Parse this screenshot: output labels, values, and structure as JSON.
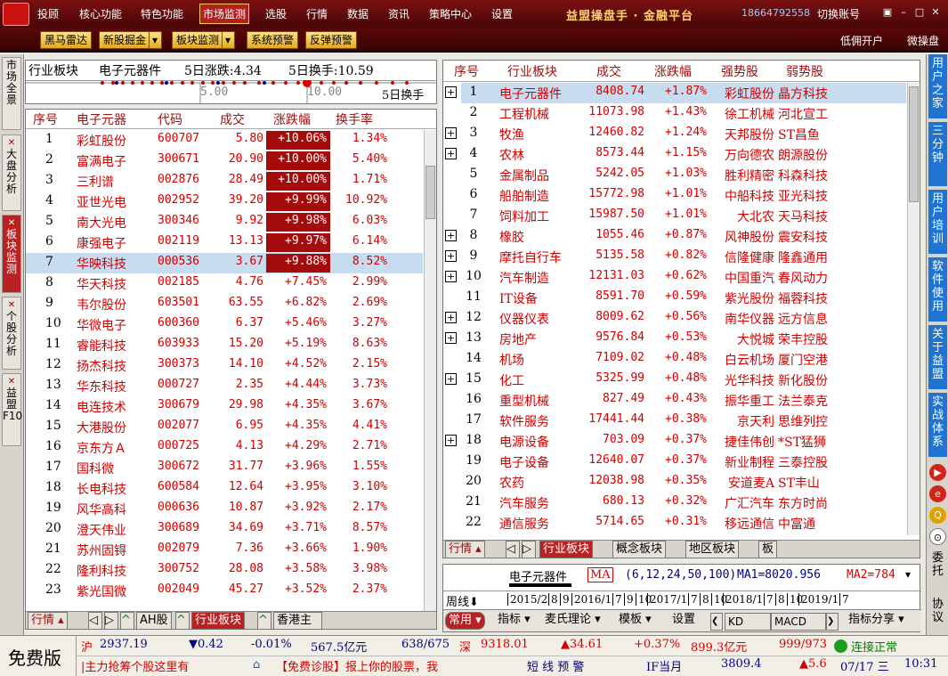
{
  "menu": {
    "items": [
      "投顾",
      "核心功能",
      "特色功能",
      "市场监测",
      "选股",
      "行情",
      "数据",
      "资讯",
      "策略中心",
      "设置"
    ],
    "active": "市场监测",
    "brand": "益盟操盘手 · 金融平台",
    "phone": "18664792558",
    "switch_account": "切换账号"
  },
  "toolbar": {
    "buttons": [
      "黑马雷达",
      "新股掘金",
      "板块监测",
      "系统预警",
      "反弹预警"
    ],
    "right": [
      "低佣开户",
      "微操盘"
    ]
  },
  "left_tabs": [
    "市场全景",
    "大盘分析",
    "板块监测",
    "个股分析",
    "益盟F10"
  ],
  "right_tabs": [
    "用户之家",
    "三分钟",
    "用户培训",
    "软件使用",
    "关于益盟",
    "实战体系"
  ],
  "right_text": [
    "委托",
    "协议"
  ],
  "sector_summary": {
    "title": "行业板块",
    "name": "电子元器件",
    "change_label": "5日涨跌:4.34",
    "turnover_label": "5日换手:10.59",
    "ticks": [
      "5.00",
      "10.00"
    ],
    "axis_label": "5日换手"
  },
  "stock_table": {
    "headers": [
      "序号",
      "电子元器",
      "代码",
      "成交",
      "涨跌幅",
      "换手率"
    ],
    "rows": [
      [
        "1",
        "彩虹股份",
        "600707",
        "5.80",
        "+10.06%",
        "1.34%"
      ],
      [
        "2",
        "富满电子",
        "300671",
        "20.90",
        "+10.00%",
        "5.40%"
      ],
      [
        "3",
        "三利谱",
        "002876",
        "28.49",
        "+10.00%",
        "1.71%"
      ],
      [
        "4",
        "亚世光电",
        "002952",
        "39.20",
        "+9.99%",
        "10.92%"
      ],
      [
        "5",
        "南大光电",
        "300346",
        "9.92",
        "+9.98%",
        "6.03%"
      ],
      [
        "6",
        "康强电子",
        "002119",
        "13.13",
        "+9.97%",
        "6.14%"
      ],
      [
        "7",
        "华映科技",
        "000536",
        "3.67",
        "+9.88%",
        "8.52%"
      ],
      [
        "8",
        "华天科技",
        "002185",
        "4.76",
        "+7.45%",
        "2.99%"
      ],
      [
        "9",
        "韦尔股份",
        "603501",
        "63.55",
        "+6.82%",
        "2.69%"
      ],
      [
        "10",
        "华微电子",
        "600360",
        "6.37",
        "+5.46%",
        "3.27%"
      ],
      [
        "11",
        "睿能科技",
        "603933",
        "15.20",
        "+5.19%",
        "8.63%"
      ],
      [
        "12",
        "扬杰科技",
        "300373",
        "14.10",
        "+4.52%",
        "2.15%"
      ],
      [
        "13",
        "华东科技",
        "000727",
        "2.35",
        "+4.44%",
        "3.73%"
      ],
      [
        "14",
        "电连技术",
        "300679",
        "29.98",
        "+4.35%",
        "3.67%"
      ],
      [
        "15",
        "大港股份",
        "002077",
        "6.95",
        "+4.35%",
        "4.41%"
      ],
      [
        "16",
        "京东方Ａ",
        "000725",
        "4.13",
        "+4.29%",
        "2.71%"
      ],
      [
        "17",
        "国科微",
        "300672",
        "31.77",
        "+3.96%",
        "1.55%"
      ],
      [
        "18",
        "长电科技",
        "600584",
        "12.64",
        "+3.95%",
        "3.10%"
      ],
      [
        "19",
        "风华高科",
        "000636",
        "10.87",
        "+3.92%",
        "2.17%"
      ],
      [
        "20",
        "澄天伟业",
        "300689",
        "34.69",
        "+3.71%",
        "8.57%"
      ],
      [
        "21",
        "苏州固锝",
        "002079",
        "7.36",
        "+3.66%",
        "1.90%"
      ],
      [
        "22",
        "隆利科技",
        "300752",
        "28.08",
        "+3.58%",
        "3.98%"
      ],
      [
        "23",
        "紫光国微",
        "002049",
        "45.27",
        "+3.52%",
        "2.37%"
      ]
    ],
    "limit_up_rows": 7,
    "selected_row": 7
  },
  "left_bottom_tabs": [
    "行情",
    "AH股",
    "行业板块",
    "香港主"
  ],
  "sector_table": {
    "headers": [
      "序号",
      "行业板块",
      "成交",
      "涨跌幅",
      "强势股",
      "弱势股"
    ],
    "rows": [
      [
        "1",
        "电子元器件",
        "8408.74",
        "+1.87%",
        "彩虹股份",
        "晶方科技"
      ],
      [
        "2",
        "工程机械",
        "11073.98",
        "+1.43%",
        "徐工机械",
        "河北宣工"
      ],
      [
        "3",
        "牧渔",
        "12460.82",
        "+1.24%",
        "天邦股份",
        "ST昌鱼"
      ],
      [
        "4",
        "农林",
        "8573.44",
        "+1.15%",
        "万向德农",
        "朗源股份"
      ],
      [
        "5",
        "金属制品",
        "5242.05",
        "+1.03%",
        "胜利精密",
        "科森科技"
      ],
      [
        "6",
        "船舶制造",
        "15772.98",
        "+1.01%",
        "中船科技",
        "亚光科技"
      ],
      [
        "7",
        "饲料加工",
        "15987.50",
        "+1.01%",
        "大北农",
        "天马科技"
      ],
      [
        "8",
        "橡胶",
        "1055.46",
        "+0.87%",
        "风神股份",
        "震安科技"
      ],
      [
        "9",
        "摩托自行车",
        "5135.58",
        "+0.82%",
        "信隆健康",
        "隆鑫通用"
      ],
      [
        "10",
        "汽车制造",
        "12131.03",
        "+0.62%",
        "中国重汽",
        "春风动力"
      ],
      [
        "11",
        "IT设备",
        "8591.70",
        "+0.59%",
        "紫光股份",
        "福蓉科技"
      ],
      [
        "12",
        "仪器仪表",
        "8009.62",
        "+0.56%",
        "南华仪器",
        "远方信息"
      ],
      [
        "13",
        "房地产",
        "9576.84",
        "+0.53%",
        "大悦城",
        "荣丰控股"
      ],
      [
        "14",
        "机场",
        "7109.02",
        "+0.48%",
        "白云机场",
        "厦门空港"
      ],
      [
        "15",
        "化工",
        "5325.99",
        "+0.48%",
        "光华科技",
        "新化股份"
      ],
      [
        "16",
        "重型机械",
        "827.49",
        "+0.43%",
        "振华重工",
        "法兰泰克"
      ],
      [
        "17",
        "软件服务",
        "17441.44",
        "+0.38%",
        "京天利",
        "思维列控"
      ],
      [
        "18",
        "电源设备",
        "703.09",
        "+0.37%",
        "捷佳伟创",
        "*ST猛狮"
      ],
      [
        "19",
        "电子设备",
        "12640.07",
        "+0.37%",
        "新业制程",
        "三泰控股"
      ],
      [
        "20",
        "农药",
        "12038.98",
        "+0.35%",
        "安道麦A",
        "ST丰山"
      ],
      [
        "21",
        "汽车服务",
        "680.13",
        "+0.32%",
        "广汇汽车",
        "东方时尚"
      ],
      [
        "22",
        "通信服务",
        "5714.65",
        "+0.31%",
        "移远通信",
        "中富通"
      ]
    ],
    "plus_rows": [
      1,
      3,
      4,
      8,
      9,
      10,
      12,
      13,
      15,
      18
    ],
    "selected_row": 1
  },
  "right_bottom_tabs": [
    "行情",
    "行业板块",
    "概念板块",
    "地区板块",
    "板"
  ],
  "kline": {
    "name": "电子元器件",
    "ma_label": "MA",
    "ma_params": "(6,12,24,50,100)",
    "ma1": "MA1=8020.956",
    "ma2": "MA2=784",
    "period": "周线",
    "dates": [
      "2015/2",
      "8",
      "9",
      "2016/1",
      "7",
      "9",
      "10",
      "2017/1",
      "7",
      "8",
      "10",
      "2018/1",
      "7",
      "8",
      "10",
      "2019/1",
      "7"
    ],
    "toolbar": [
      "常用",
      "指标",
      "麦氏理论",
      "模板",
      "设置",
      "KD",
      "MACD",
      "指标分享"
    ]
  },
  "status": {
    "free": "免费版",
    "sh_label": "沪",
    "sh_index": "2937.19",
    "sh_change": "▼0.42",
    "sh_pct": "-0.01%",
    "sh_amount": "567.5亿元",
    "sh_count": "638/675",
    "sz_label": "深",
    "sz_index": "9318.01",
    "sz_change": "▲34.61",
    "sz_pct": "+0.37%",
    "sz_amount": "899.3亿元",
    "sz_count": "999/973",
    "connection": "连接正常",
    "ticker1": "主力抢筹个股这里有",
    "ticker2": "【免费诊股】报上你的股票，我",
    "alert": "短 线 预 警",
    "if_label": "IF当月",
    "if_value": "3809.4",
    "if_change": "▲5.6",
    "date": "07/17 三",
    "time": "10:31"
  }
}
